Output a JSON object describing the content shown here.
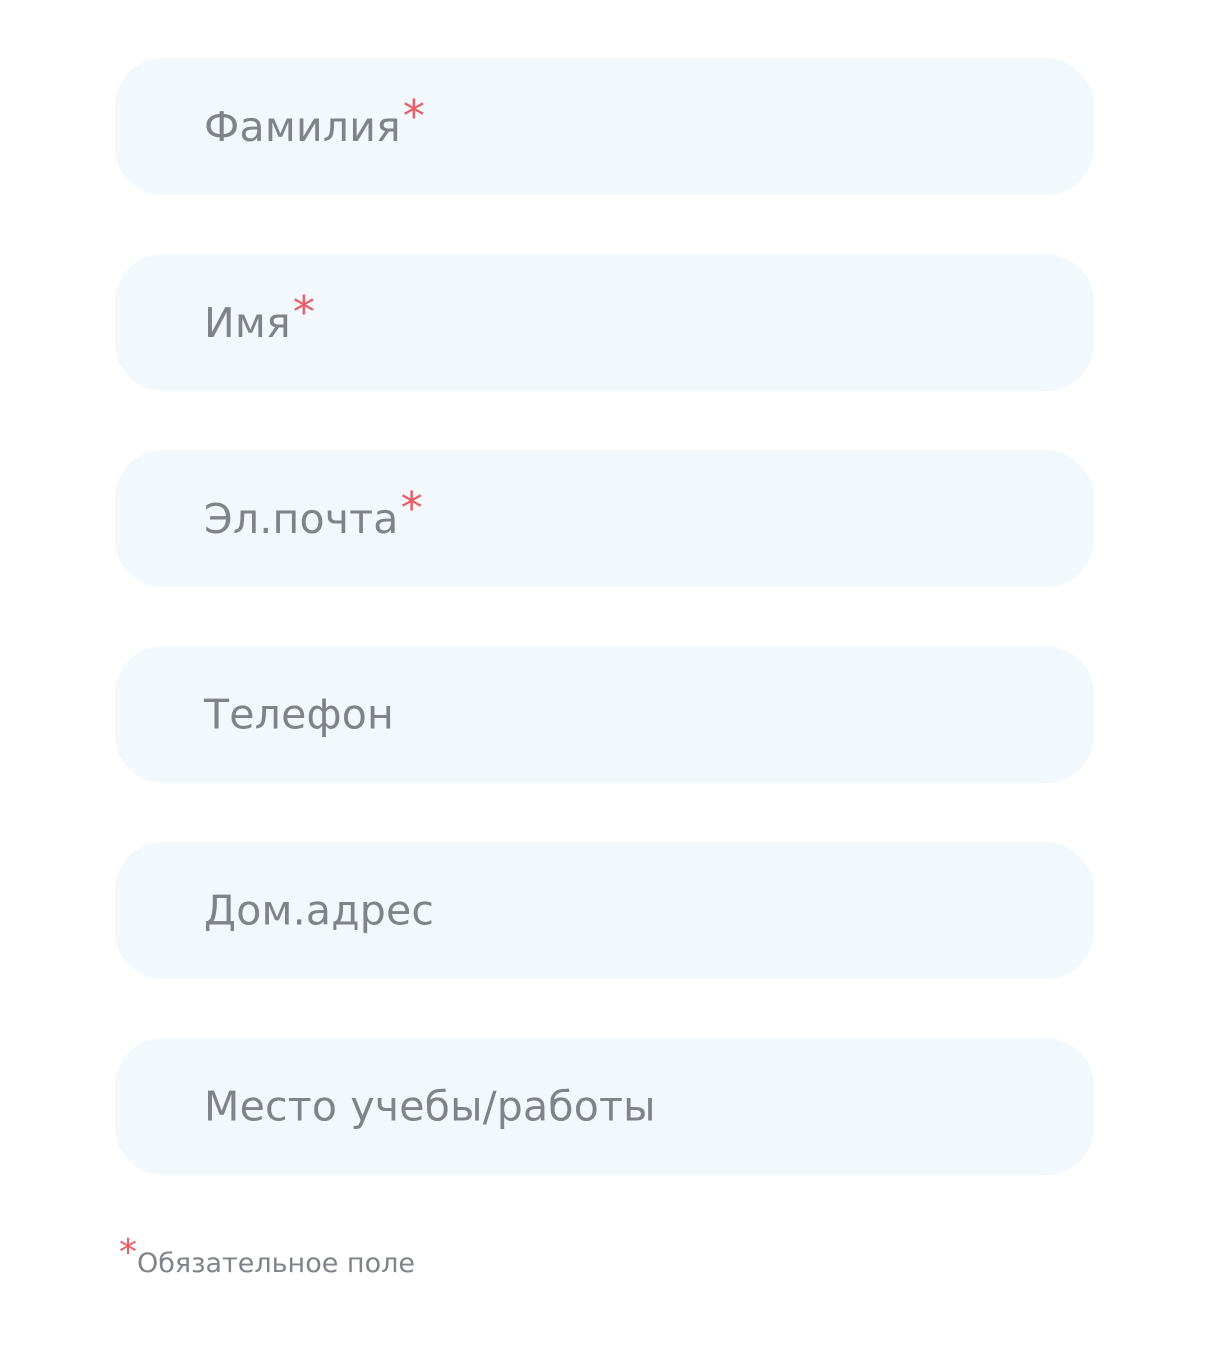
{
  "form": {
    "fields": [
      {
        "label": "Фамилия",
        "required": true,
        "value": ""
      },
      {
        "label": "Имя",
        "required": true,
        "value": ""
      },
      {
        "label": "Эл.почта",
        "required": true,
        "value": ""
      },
      {
        "label": "Телефон",
        "required": false,
        "value": ""
      },
      {
        "label": "Дом.адрес",
        "required": false,
        "value": ""
      },
      {
        "label": "Место учебы/работы",
        "required": false,
        "value": ""
      }
    ],
    "required_marker": "*",
    "required_note": "Обязательное поле"
  },
  "colors": {
    "field_background": "#f3f8fd",
    "label_text": "#808389",
    "required_marker": "#ec5b66",
    "page_background": "#ffffff"
  }
}
